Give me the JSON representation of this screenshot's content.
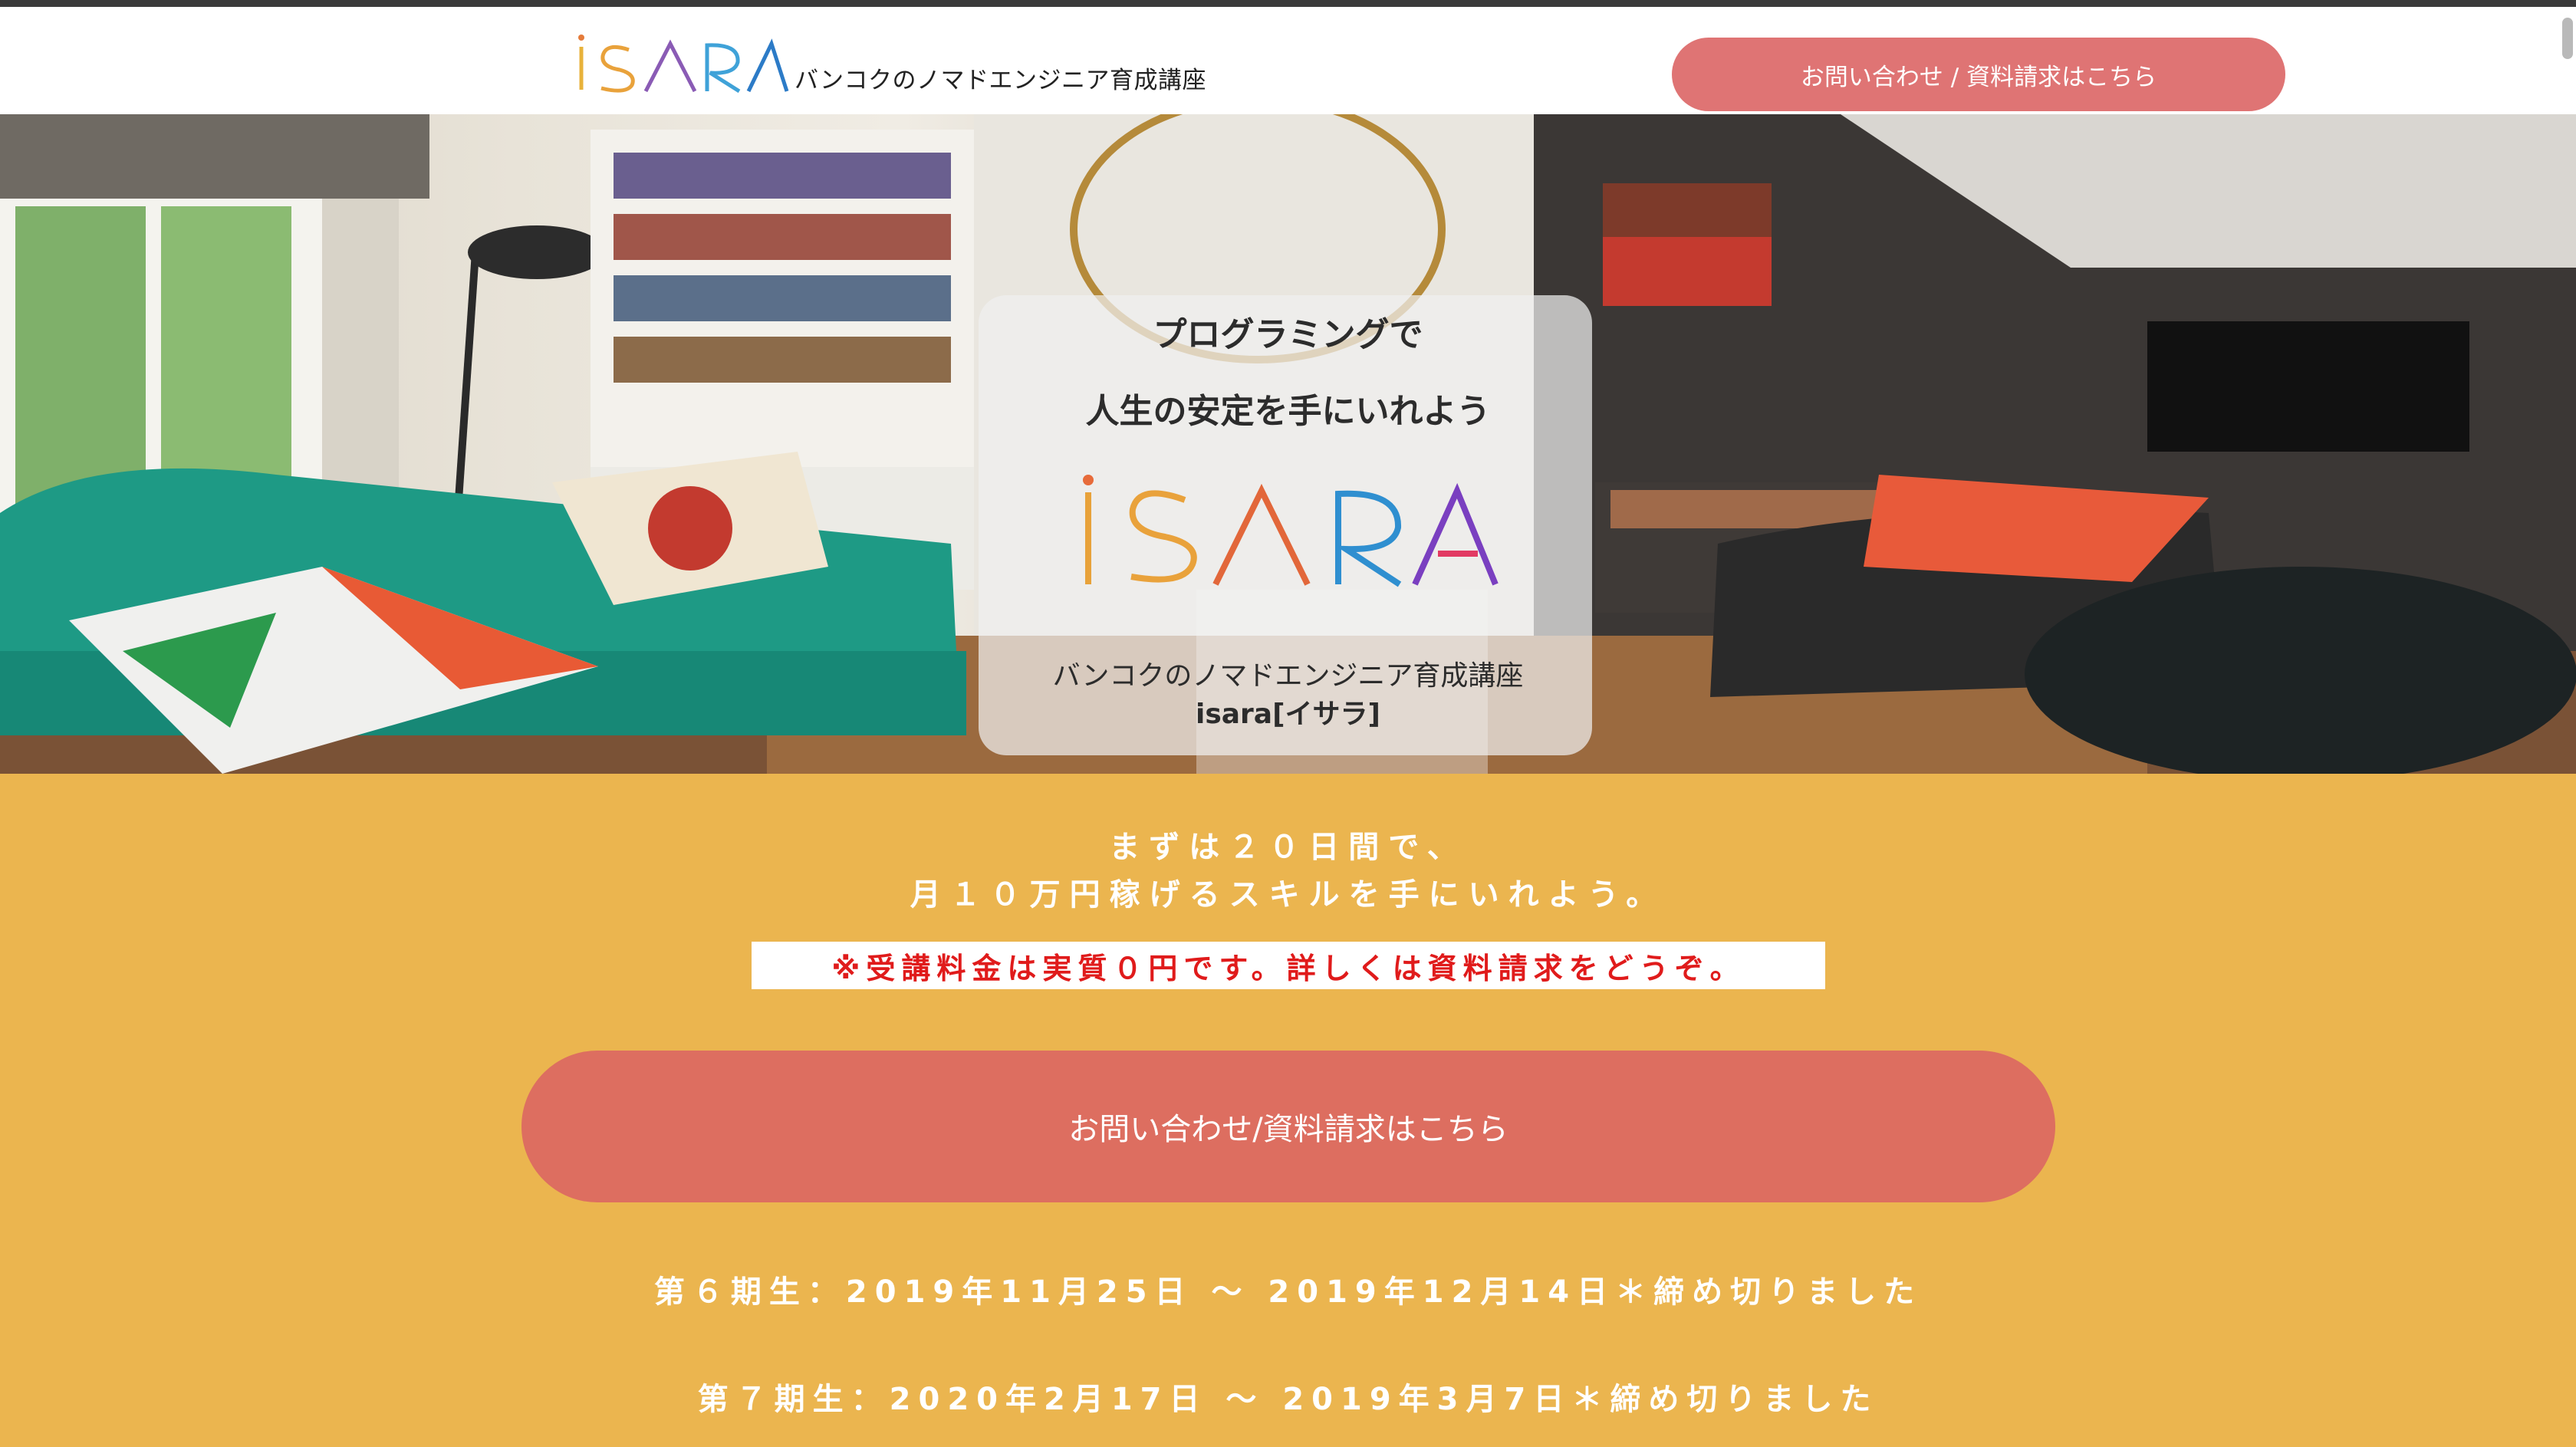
{
  "header": {
    "logo_text": "ISARA",
    "tagline": "バンコクのノマドエンジニア育成講座",
    "contact_button": "お問い合わせ / 資料請求はこちら"
  },
  "hero": {
    "headline_line1": "プログラミングで",
    "headline_line2": "人生の安定を手にいれよう",
    "logo_text": "ISARA",
    "subtitle_line1": "バンコクのノマドエンジニア育成講座",
    "subtitle_line2": "isara[イサラ]"
  },
  "main": {
    "lead_line1": "まずは２０日間で、",
    "lead_line2": "月１０万円稼げるスキルを手にいれよう。",
    "notice": "※受講料金は実質０円です。詳しくは資料請求をどうぞ。",
    "cta_button": "お問い合わせ/資料請求はこちら",
    "terms": [
      "第６期生：2019年11月25日 ～ 2019年12月14日＊締め切りました",
      "第７期生：2020年2月17日 ～ 2019年3月7日＊締め切りました"
    ]
  },
  "colors": {
    "background": "#ebb54f",
    "header_button": "#df7474",
    "cta_button": "#dd6e60",
    "notice_text": "#e01b1b"
  }
}
